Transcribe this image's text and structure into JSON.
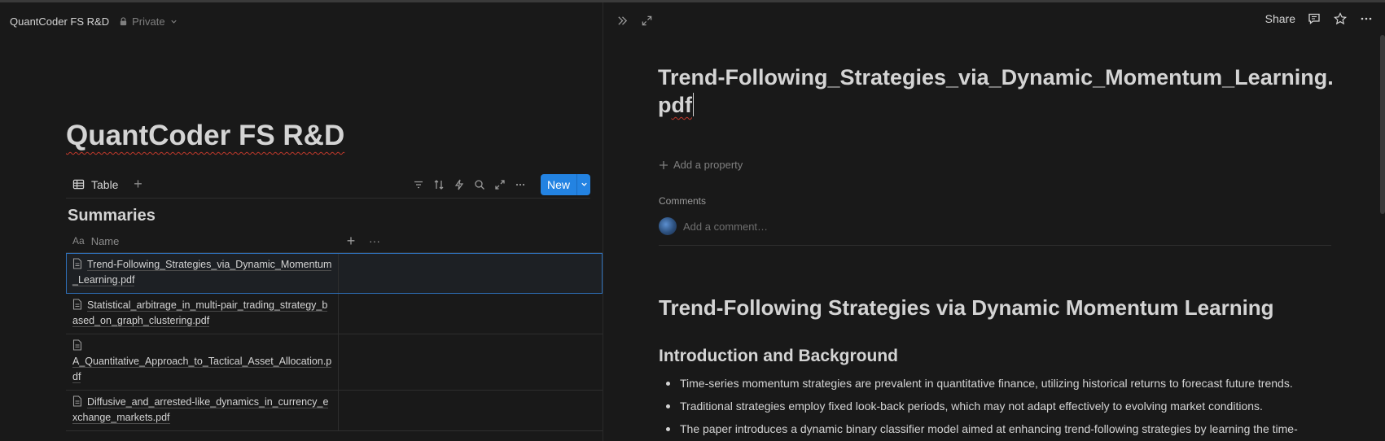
{
  "left": {
    "breadcrumb": "QuantCoder FS R&D",
    "privacy": "Private",
    "page_title": "QuantCoder FS R&D",
    "view_tab": "Table",
    "new_button": "New",
    "group_title": "Summaries",
    "table": {
      "name_type_icon": "Aa",
      "name_header": "Name",
      "rows": [
        {
          "name": "Trend-Following_Strategies_via_Dynamic_Momentum_Learning.pdf"
        },
        {
          "name": "Statistical_arbitrage_in_multi-pair_trading_strategy_based_on_graph_clustering.pdf"
        },
        {
          "name": "A_Quantitative_Approach_to_Tactical_Asset_Allocation.pdf"
        },
        {
          "name": "Diffusive_and_arrested-like_dynamics_in_currency_exchange_markets.pdf"
        }
      ]
    }
  },
  "right": {
    "share_label": "Share",
    "doc_title_main": "Trend-Following_Strategies_via_Dynamic_Momentum_Learning.p",
    "doc_title_tail": "df",
    "add_property": "Add a property",
    "comments_label": "Comments",
    "add_comment_placeholder": "Add a comment…",
    "heading1": "Trend-Following Strategies via Dynamic Momentum Learning",
    "heading2": "Introduction and Background",
    "bullets": [
      "Time-series momentum strategies are prevalent in quantitative finance, utilizing historical returns to forecast future trends.",
      "Traditional strategies employ fixed look-back periods, which may not adapt effectively to evolving market conditions.",
      "The paper introduces a dynamic binary classifier model aimed at enhancing trend-following strategies by learning the time-"
    ]
  },
  "colors": {
    "background": "#191919",
    "accent": "#2383e2",
    "text": "#d4d4d4",
    "muted": "#7f7f7f"
  }
}
